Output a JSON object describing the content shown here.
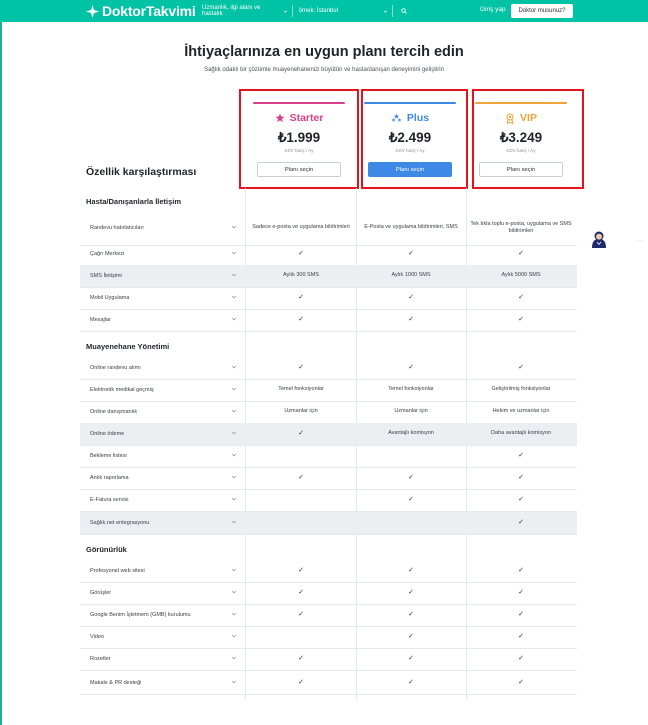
{
  "header": {
    "brand": "DoktorTakvimi",
    "search_specialty_placeholder": "Uzmanlık, ilgi alanı ve hastalık",
    "search_location_placeholder": "örnek: İstanbul",
    "login_label": "Giriş yap",
    "doctor_button_label": "Doktor musunuz?"
  },
  "page": {
    "title": "İhtiyaçlarınıza en uygun planı tercih edin",
    "subtitle": "Sağlık odaklı bir çözümle muayenehanenizi büyütün ve hasta/danışan deneyimini geliştirin"
  },
  "plans": [
    {
      "name": "Starter",
      "price": "₺1.999",
      "vat": "KDV hariç / Ay",
      "button": "Planı seçin",
      "color": "#d9418e",
      "icon": "star-icon"
    },
    {
      "name": "Plus",
      "price": "₺2.499",
      "vat": "KDV hariç / Ay",
      "button": "Planı seçin",
      "color": "#3e88e6",
      "icon": "stars-icon"
    },
    {
      "name": "VIP",
      "price": "₺3.249",
      "vat": "KDV hariç / Ay",
      "button": "Planı seçin",
      "color": "#f0a23b",
      "icon": "medal-icon"
    }
  ],
  "comparison": {
    "title": "Özellik karşılaştırması",
    "sections": [
      {
        "title": "Hasta/Danışanlarla İletişim",
        "rows": [
          {
            "label": "Randevu hatırlatıcıları",
            "values": [
              "Sadece e-posta ve uygulama bildirimleri",
              "E-Posta ve uygulama bildirimleri, SMS",
              "Tek tıkla toplu e-posta, uygulama ve SMS bildirimleri"
            ]
          },
          {
            "label": "Çağrı Merkezi",
            "values": [
              "✓",
              "✓",
              "✓"
            ]
          },
          {
            "label": "SMS İletişimi",
            "values": [
              "Aylık 300 SMS",
              "Aylık 1000 SMS",
              "Aylık 5000 SMS"
            ]
          },
          {
            "label": "Mobil Uygulama",
            "values": [
              "✓",
              "✓",
              "✓"
            ]
          },
          {
            "label": "Mesajlar",
            "values": [
              "✓",
              "✓",
              "✓"
            ]
          }
        ]
      },
      {
        "title": "Muayenehane Yönetimi",
        "rows": [
          {
            "label": "Online randevu alımı",
            "values": [
              "✓",
              "✓",
              "✓"
            ]
          },
          {
            "label": "Elektronik medikal geçmiş",
            "values": [
              "Temel fonksiyonlar",
              "Temel fonksiyonlar",
              "Geliştirilmiş fonksiyonlar"
            ]
          },
          {
            "label": "Online danışmanlık",
            "values": [
              "Uzmanlar için",
              "Uzmanlar için",
              "Hekim ve uzmanlar için"
            ]
          },
          {
            "label": "Online ödeme",
            "values": [
              "✓",
              "Avantajlı komisyon",
              "Daha avantajlı komisyon"
            ]
          },
          {
            "label": "Bekleme listesi",
            "values": [
              "",
              "",
              "✓"
            ]
          },
          {
            "label": "Anlık raporlama",
            "values": [
              "✓",
              "✓",
              "✓"
            ]
          },
          {
            "label": "E-Fatura servisi",
            "values": [
              "",
              "✓",
              "✓"
            ]
          },
          {
            "label": "Sağlık.net entegrasyonu",
            "values": [
              "",
              "",
              "✓"
            ]
          }
        ]
      },
      {
        "title": "Görünürlük",
        "rows": [
          {
            "label": "Profesyonel web sitesi",
            "values": [
              "✓",
              "✓",
              "✓"
            ]
          },
          {
            "label": "Görüşler",
            "values": [
              "✓",
              "✓",
              "✓"
            ]
          },
          {
            "label": "Google Benim İşletmem (GMB) kurulumu",
            "values": [
              "✓",
              "✓",
              "✓"
            ]
          },
          {
            "label": "Video",
            "values": [
              "",
              "✓",
              "✓"
            ]
          },
          {
            "label": "Rozetler",
            "values": [
              "✓",
              "✓",
              "✓"
            ]
          },
          {
            "label": "Makale & PR desteği",
            "values": [
              "✓",
              "✓",
              "✓"
            ]
          }
        ]
      }
    ]
  }
}
